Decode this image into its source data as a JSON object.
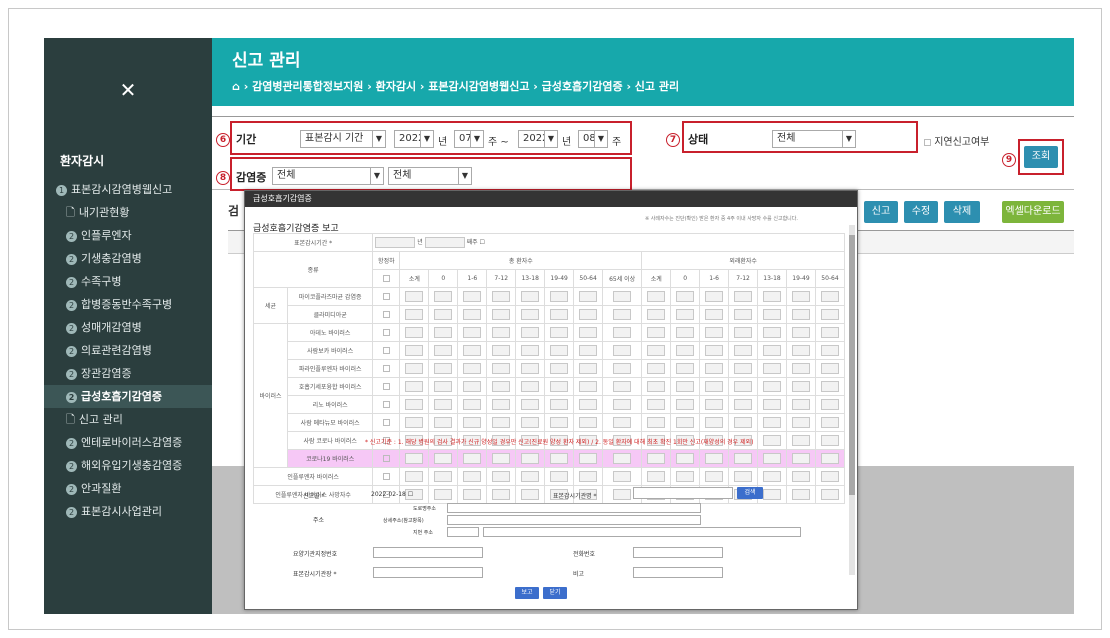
{
  "sidebar": {
    "close_icon": "✕",
    "section_title": "환자감시",
    "items": [
      {
        "num": "1",
        "label": "표본감시감염병웹신고",
        "type": "top"
      },
      {
        "num": "",
        "label": "내기관현황",
        "type": "doc"
      },
      {
        "num": "2",
        "label": "인플루엔자",
        "type": "num"
      },
      {
        "num": "2",
        "label": "기생충감염병",
        "type": "num"
      },
      {
        "num": "2",
        "label": "수족구병",
        "type": "num"
      },
      {
        "num": "2",
        "label": "합병증동반수족구병",
        "type": "num"
      },
      {
        "num": "2",
        "label": "성매개감염병",
        "type": "num"
      },
      {
        "num": "2",
        "label": "의료관련감염병",
        "type": "num"
      },
      {
        "num": "2",
        "label": "장관감염증",
        "type": "num"
      },
      {
        "num": "2",
        "label": "급성호흡기감염증",
        "type": "active"
      },
      {
        "num": "",
        "label": "신고 관리",
        "type": "doc"
      },
      {
        "num": "2",
        "label": "엔테로바이러스감염증",
        "type": "num"
      },
      {
        "num": "2",
        "label": "해외유입기생충감염증",
        "type": "num"
      },
      {
        "num": "2",
        "label": "안과질환",
        "type": "num"
      },
      {
        "num": "2",
        "label": "표본감시사업관리",
        "type": "num"
      }
    ]
  },
  "header": {
    "title": "신고 관리",
    "home_icon": "⌂",
    "breadcrumb": "› 감염병관리통합정보지원 › 환자감시 › 표본감시감염병웹신고 › 급성호흡기감염증 › 신고 관리"
  },
  "filter": {
    "period_label": "기간",
    "period_type": "표본감시 기간",
    "year1": "2022",
    "year_unit1": "년",
    "week1": "07",
    "week_unit1": "주 ~",
    "year2": "2022",
    "year_unit2": "년",
    "week2": "08",
    "week_unit2": "주",
    "status_label": "상태",
    "status_value": "전체",
    "delay_label": "지연신고여부",
    "infection_label": "감염증",
    "infection_value1": "전체",
    "infection_value2": "전체",
    "search_button": "조회",
    "markers": [
      "6",
      "7",
      "8",
      "9"
    ]
  },
  "toolbar": {
    "left_label": "검",
    "report": "신고",
    "edit": "수정",
    "delete": "삭제",
    "excel": "엑셀다운로드"
  },
  "modal": {
    "header": "급성호흡기감염증",
    "title": "급성호흡기감염증 보고",
    "note": "※ 사례자수는 진단(확인) 받은 환자 중 4주 이내 사망자 수를 신고합니다.",
    "period_label": "표본감시기간 *",
    "period_year_unit": "년",
    "period_week_unit": "째주",
    "col_type": "종류",
    "col_hospital": "항정하",
    "col_total": "총 환자수",
    "col_outpatient": "외래환자수",
    "age_cols": [
      "소계",
      "0",
      "1-6",
      "7-12",
      "13-18",
      "19-49",
      "50-64",
      "65세 이상"
    ],
    "age_cols2": [
      "소계",
      "0",
      "1-6",
      "7-12",
      "13-18",
      "19-49",
      "50-64"
    ],
    "group_bacteria": "세균",
    "group_virus": "바이러스",
    "bacteria_rows": [
      "마이코플라즈마균 감염증",
      "클라미디아균"
    ],
    "virus_rows": [
      "아데노 바이러스",
      "사람보카 바이러스",
      "파라인플루엔자 바이러스",
      "호흡기세포융합 바이러스",
      "리노 바이러스",
      "사람 메타뉴모 바이러스",
      "사람 코로나 바이러스",
      "코로나19 바이러스"
    ],
    "extra_rows": [
      "인플루엔자 바이러스",
      "인플루엔자 바이러스 사망자수"
    ],
    "red_note": "* 신고기준 : 1. 해당 병원의 검사 결과가 신규 양성일 경우만 신고(진료원 양성 환자 제외) / 2. 동일 환자에 대해 최초 확진 1회만 신고(재양성의 경우 제외)",
    "report_date_label": "신고일 *",
    "report_date": "2022-02-18",
    "institution_label": "표본감시기관명 *",
    "search_btn": "검색",
    "address_label": "주소",
    "road_label": "도로명주소",
    "detail_label": "상세주소(참고항목)",
    "jibun_label": "지번 주소",
    "care_no_label": "요양기관지정번호",
    "phone_label": "전화번호",
    "manager_label": "표본감시기관장 *",
    "memo_label": "비고",
    "report_btn": "보고",
    "close_btn": "닫기"
  },
  "colors": {
    "header": "#17a8ab",
    "sidebar": "#2b3e3e",
    "annotation": "#c8202c",
    "button_blue": "#2d8fb0",
    "button_green": "#7db53b"
  }
}
